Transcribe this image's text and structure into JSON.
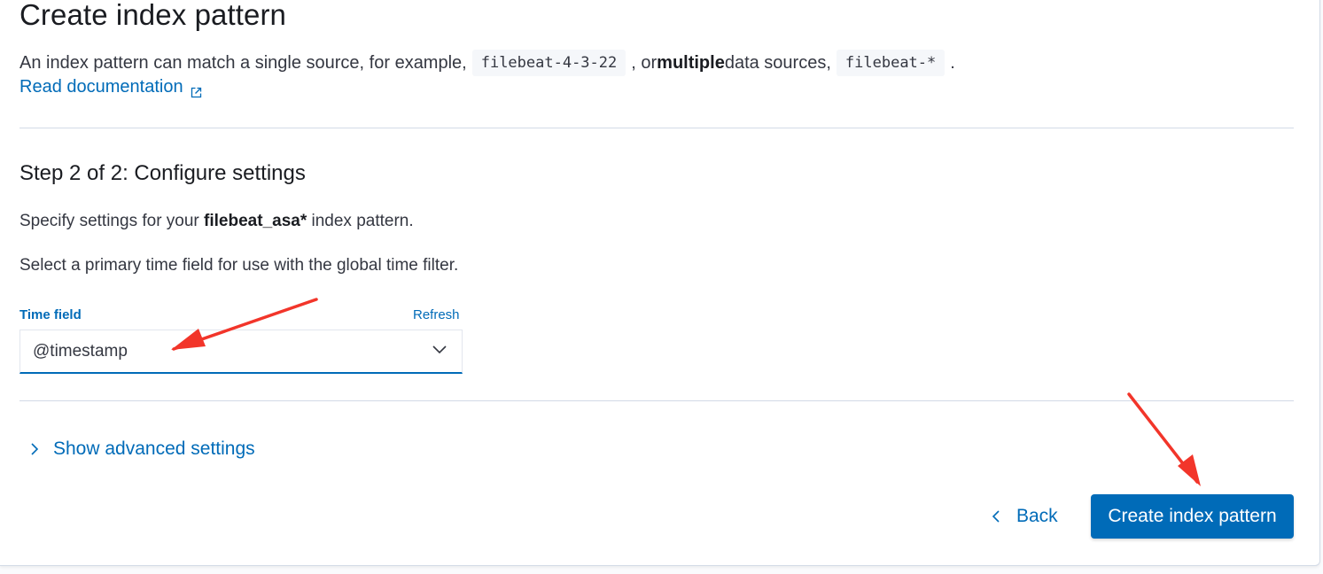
{
  "page": {
    "title": "Create index pattern",
    "intro_part1": "An index pattern can match a single source, for example, ",
    "intro_code1": "filebeat-4-3-22",
    "intro_part2": ", or ",
    "intro_bold": "multiple",
    "intro_part3": " data sources, ",
    "intro_code2": "filebeat-*",
    "intro_part4": ".",
    "doc_link": "Read documentation"
  },
  "step": {
    "title": "Step 2 of 2: Configure settings",
    "specify_prefix": "Specify settings for your ",
    "pattern_name": "filebeat_asa*",
    "specify_suffix": " index pattern.",
    "time_hint": "Select a primary time field for use with the global time filter."
  },
  "time_field": {
    "label": "Time field",
    "refresh": "Refresh",
    "selected": "@timestamp"
  },
  "advanced": {
    "label": "Show advanced settings"
  },
  "actions": {
    "back": "Back",
    "create": "Create index pattern"
  },
  "colors": {
    "accent": "#006bb8",
    "annotation_arrow": "#f2352a"
  },
  "icons": {
    "doc_link": "external-link-icon",
    "select": "chevron-down-icon",
    "advanced": "chevron-right-icon",
    "back": "chevron-left-icon"
  }
}
